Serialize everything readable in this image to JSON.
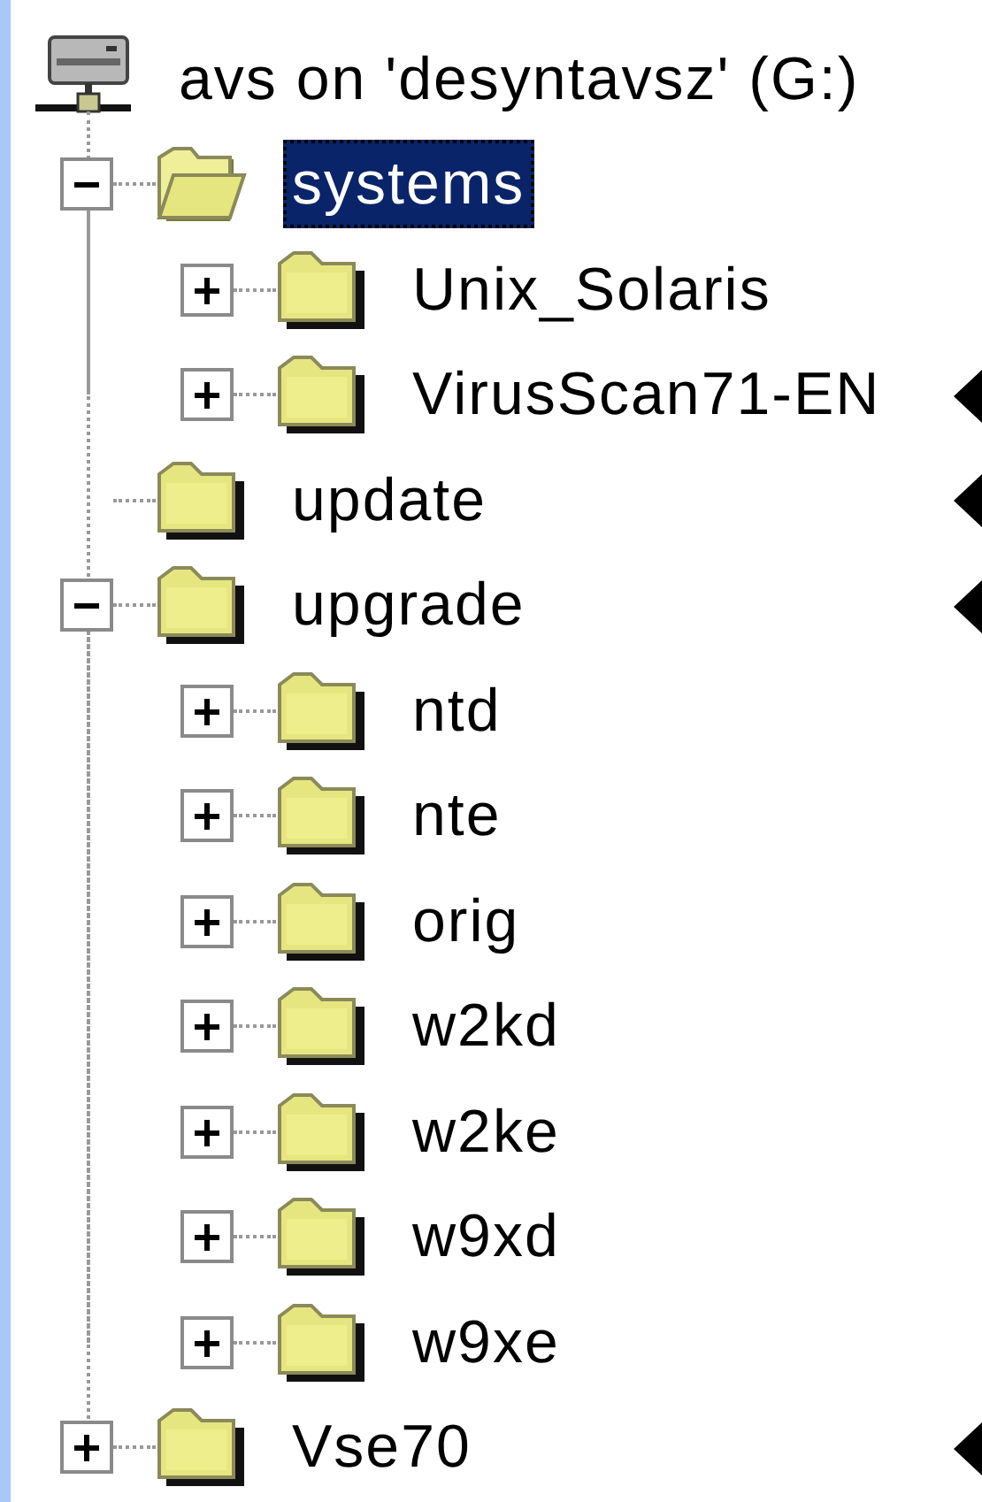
{
  "tree": {
    "root": {
      "kind": "drive",
      "label": "avs on 'desyntavsz' (G:)",
      "children": [
        {
          "kind": "folder",
          "label": "systems",
          "expandable": true,
          "expanded": true,
          "selected": true,
          "pointer": false,
          "children": [
            {
              "kind": "folder",
              "label": "Unix_Solaris",
              "expandable": true,
              "expanded": false,
              "selected": false,
              "pointer": false
            },
            {
              "kind": "folder",
              "label": "VirusScan71-EN",
              "expandable": true,
              "expanded": false,
              "selected": false,
              "pointer": true
            }
          ]
        },
        {
          "kind": "folder",
          "label": "update",
          "expandable": false,
          "expanded": false,
          "selected": false,
          "pointer": true
        },
        {
          "kind": "folder",
          "label": "upgrade",
          "expandable": true,
          "expanded": true,
          "selected": false,
          "pointer": true,
          "children": [
            {
              "kind": "folder",
              "label": "ntd",
              "expandable": true,
              "expanded": false,
              "selected": false,
              "pointer": false
            },
            {
              "kind": "folder",
              "label": "nte",
              "expandable": true,
              "expanded": false,
              "selected": false,
              "pointer": false
            },
            {
              "kind": "folder",
              "label": "orig",
              "expandable": true,
              "expanded": false,
              "selected": false,
              "pointer": false
            },
            {
              "kind": "folder",
              "label": "w2kd",
              "expandable": true,
              "expanded": false,
              "selected": false,
              "pointer": false
            },
            {
              "kind": "folder",
              "label": "w2ke",
              "expandable": true,
              "expanded": false,
              "selected": false,
              "pointer": false
            },
            {
              "kind": "folder",
              "label": "w9xd",
              "expandable": true,
              "expanded": false,
              "selected": false,
              "pointer": false
            },
            {
              "kind": "folder",
              "label": "w9xe",
              "expandable": true,
              "expanded": false,
              "selected": false,
              "pointer": false
            }
          ]
        },
        {
          "kind": "folder",
          "label": "Vse70",
          "expandable": true,
          "expanded": false,
          "selected": false,
          "pointer": true
        }
      ]
    }
  }
}
